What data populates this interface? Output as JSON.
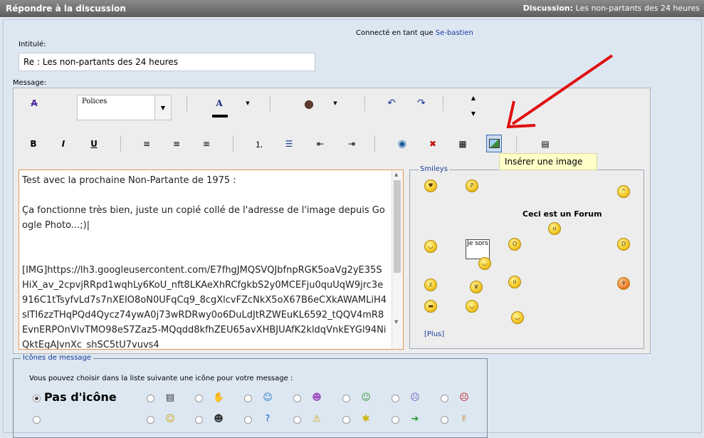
{
  "header": {
    "title": "Répondre à la discussion",
    "discussion_label": "Discussion:",
    "discussion_title": "Les non-partants des 24 heures"
  },
  "connected": {
    "prefix": "Connecté en tant que",
    "username": "Se-bastien"
  },
  "form": {
    "title_label": "Intitulé:",
    "title_value": "Re : Les non-partants des 24 heures",
    "message_label": "Message:"
  },
  "toolbar": {
    "font_select": "Polices",
    "tooltip": "Insérer une image"
  },
  "message_text": "Test avec la prochaine Non-Partante de 1975 :\n\nÇa fonctionne très bien, juste un copié collé de l'adresse de l'image depuis Google Photo...;)|\n\n\n[IMG]https://lh3.googleusercontent.com/E7fhgJMQSVQJbfnpRGK5oaVg2yE35SHiX_av_2cpvjRRpd1wqhLy6KoU_nft8LKAeXhRCfgkbS2y0MCEFju0quUqW9jrc3e916C1tTsyfvLd7s7nXEIO8oN0UFqCq9_8cgXlcvFZcNkX5oX67B6eCXkAWAMLiH4slTI6zzTHqPQd4Qycz74ywA0j73wRDRwy0o6DuLdJtRZWEuKL6592_tQQV4mR8EvnERPOnVlvTMO98eS7Zaz5-MQqdd8kfhZEU65avXHBJUAfK2kldqVnkEYGl94NiQktEgAJvnXc_shSC5tU7vuvs4",
  "smileys": {
    "legend": "Smileys",
    "forum_text": "Ceci est un Forum",
    "sign_text": "Je sors",
    "more_link": "[Plus]"
  },
  "message_icons": {
    "legend": "Icônes de message",
    "instruction": "Vous pouvez choisir dans la liste suivante une icône pour votre message :",
    "no_icon_label": "Pas d'icône",
    "row1": [
      "document-icon",
      "thumbs-down-icon",
      "wink-smiley-icon",
      "grin-smiley-icon",
      "teeth-smiley-icon",
      "sad-smiley-icon",
      "angry-smiley-icon"
    ],
    "row2": [
      "smile-icon",
      "cool-smiley-icon",
      "question-icon",
      "warning-icon",
      "lightbulb-icon",
      "arrow-right-icon",
      "thumbs-up-icon"
    ]
  },
  "colors": {
    "header_bg": "#6e6e6e",
    "panel_bg": "#dce7f2",
    "link": "#1a3a9a",
    "annotation_arrow": "#e01010"
  }
}
